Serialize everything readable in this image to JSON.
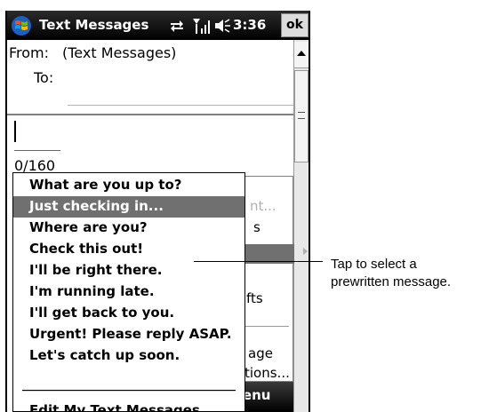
{
  "titlebar": {
    "title": "Text Messages",
    "time": "3:36",
    "ok_label": "ok",
    "icons": [
      "windows-start-icon",
      "sync-icon",
      "signal-icon",
      "volume-icon"
    ]
  },
  "header": {
    "from_label": "From:",
    "from_value": "(Text Messages)",
    "to_label": "To:",
    "to_value": ""
  },
  "body": {
    "counter": "0/160"
  },
  "underlying_menu": {
    "items": [
      "nt...",
      "s",
      "fts",
      "age",
      "tions..."
    ]
  },
  "softkey": {
    "menu_label": "Menu"
  },
  "popup": {
    "items": [
      "What are you up to?",
      "Just checking in...",
      "Where are you?",
      "Check this out!",
      "I'll be right there.",
      "I'm running late.",
      "I'll get back to you.",
      "Urgent! Please reply ASAP.",
      "Let's catch up soon."
    ],
    "selected_index": 1,
    "edit_label": "Edit My Text Messages..."
  },
  "callout": {
    "line1": "Tap to select a",
    "line2": "prewritten message."
  },
  "colors": {
    "titlebar": "#000000",
    "selection": "#707070",
    "counter_underline": "#3a6fb5"
  }
}
